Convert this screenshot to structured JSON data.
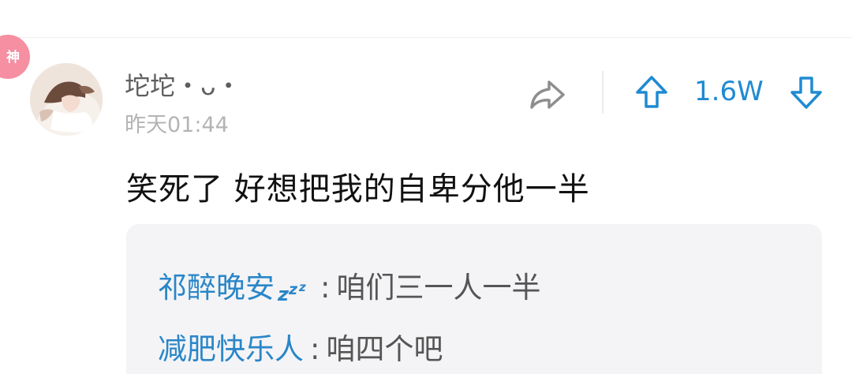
{
  "badge": {
    "label": "神",
    "color": "#f68fa1"
  },
  "post": {
    "author": "坨坨・ᴗ・",
    "timestamp": "昨天01:44",
    "content": "笑死了 好想把我的自卑分他一半"
  },
  "actions": {
    "share_icon": "share-arrow-icon",
    "upvote_icon": "up-arrow-icon",
    "downvote_icon": "down-arrow-icon",
    "vote_count": "1.6W",
    "accent_color": "#1f8ad2"
  },
  "replies": [
    {
      "name": "祁醉晚安",
      "name_icon": "zzz-sleep-icon",
      "colon": ":",
      "text": "咱们三一人一半"
    },
    {
      "name": "减肥快乐人",
      "colon": ":",
      "text": "咱四个吧"
    }
  ],
  "colors": {
    "reply_name": "#2a86c8",
    "reply_text": "#555555",
    "reply_bg": "#f4f4f6"
  }
}
